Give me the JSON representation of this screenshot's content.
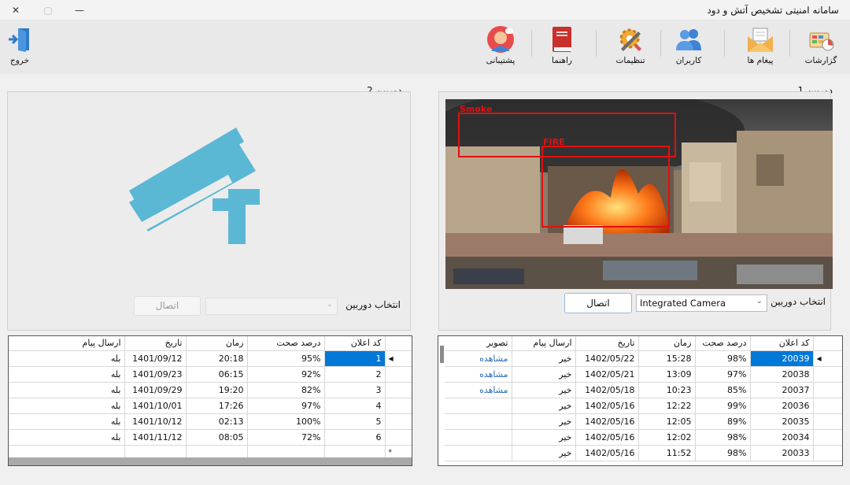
{
  "window": {
    "title": "سامانه امنیتی تشخیص آتش و دود",
    "close_glyph": "✕",
    "maximize_glyph": "▢",
    "minimize_glyph": "—"
  },
  "toolbar": {
    "reports": "گزارشات",
    "messages": "پیغام ها",
    "users": "کاربران",
    "settings": "تنظیمات",
    "help": "راهنما",
    "support": "پشتیبانی",
    "exit": "خروج"
  },
  "camera1": {
    "label": "دوربین 1",
    "select_label": "انتخاب دوربین",
    "selected": "Integrated Camera",
    "connect": "اتصال",
    "detections": [
      {
        "label": "Smoke",
        "color": "#e01010"
      },
      {
        "label": "FIRE",
        "color": "#e01010"
      }
    ]
  },
  "camera2": {
    "label": "دوربین 2",
    "select_label": "انتخاب دوربین",
    "selected": "",
    "connect": "اتصال"
  },
  "grid1": {
    "headers": [
      "کد اعلان",
      "درصد صحت",
      "زمان",
      "تاریخ",
      "ارسال پیام",
      "تصویر"
    ],
    "rows": [
      [
        "20039",
        "98%",
        "15:28",
        "1402/05/22",
        "خیر",
        "مشاهده"
      ],
      [
        "20038",
        "97%",
        "13:09",
        "1402/05/21",
        "خیر",
        "مشاهده"
      ],
      [
        "20037",
        "85%",
        "10:23",
        "1402/05/18",
        "خیر",
        "مشاهده"
      ],
      [
        "20036",
        "99%",
        "12:22",
        "1402/05/16",
        "خیر",
        ""
      ],
      [
        "20035",
        "89%",
        "12:05",
        "1402/05/16",
        "خیر",
        ""
      ],
      [
        "20034",
        "98%",
        "12:02",
        "1402/05/16",
        "خیر",
        ""
      ],
      [
        "20033",
        "98%",
        "11:52",
        "1402/05/16",
        "خیر",
        ""
      ]
    ]
  },
  "grid2": {
    "headers": [
      "کد اعلان",
      "درصد صحت",
      "زمان",
      "تاریخ",
      "ارسال پیام"
    ],
    "rows": [
      [
        "1",
        "95%",
        "20:18",
        "1401/09/12",
        "بله"
      ],
      [
        "2",
        "92%",
        "06:15",
        "1401/09/23",
        "بله"
      ],
      [
        "3",
        "82%",
        "19:20",
        "1401/09/29",
        "بله"
      ],
      [
        "4",
        "97%",
        "17:26",
        "1401/10/01",
        "بله"
      ],
      [
        "5",
        "100%",
        "02:13",
        "1401/10/12",
        "بله"
      ],
      [
        "6",
        "72%",
        "08:05",
        "1401/11/12",
        "بله"
      ]
    ]
  },
  "colors": {
    "accent": "#0078d7",
    "camera_icon": "#5bb8d4",
    "detection_box": "#e01010",
    "link": "#2a6bb5"
  }
}
